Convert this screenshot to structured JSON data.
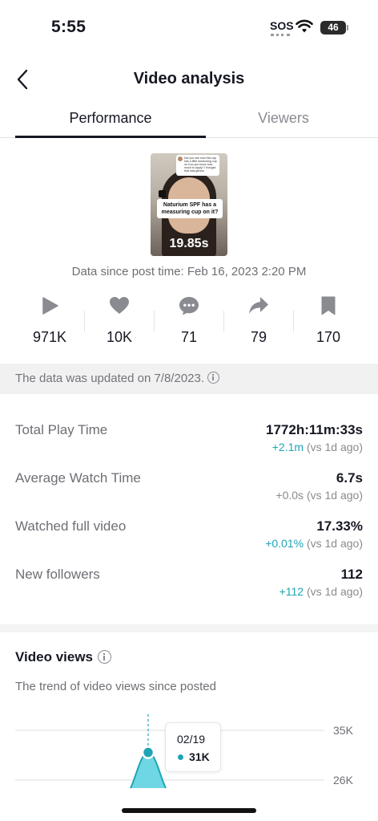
{
  "status_bar": {
    "time": "5:55",
    "sos": "SOS",
    "battery": "46"
  },
  "nav": {
    "title": "Video analysis"
  },
  "tabs": [
    {
      "label": "Performance",
      "active": true
    },
    {
      "label": "Viewers",
      "active": false
    }
  ],
  "video": {
    "duration": "19.85s",
    "caption": "Naturium SPF has a measuring cup on it?",
    "comment": "Did you see how this cap has a little measuring cup on it so you know how much to apply? I thought that was genius"
  },
  "data_since": "Data since post time: Feb 16, 2023 2:20 PM",
  "stats": [
    {
      "icon": "play-icon",
      "value": "971K"
    },
    {
      "icon": "heart-icon",
      "value": "10K"
    },
    {
      "icon": "comment-icon",
      "value": "71"
    },
    {
      "icon": "share-icon",
      "value": "79"
    },
    {
      "icon": "bookmark-icon",
      "value": "170"
    }
  ],
  "update_notice": "The data was updated on 7/8/2023.",
  "metrics": [
    {
      "label": "Total Play Time",
      "value": "1772h:11m:33s",
      "delta": "+2.1m",
      "delta_positive": true,
      "compare": " (vs 1d ago)"
    },
    {
      "label": "Average Watch Time",
      "value": "6.7s",
      "delta": "+0.0s",
      "delta_positive": false,
      "compare": " (vs 1d ago)"
    },
    {
      "label": "Watched full video",
      "value": "17.33%",
      "delta": "+0.01%",
      "delta_positive": true,
      "compare": " (vs 1d ago)"
    },
    {
      "label": "New followers",
      "value": "112",
      "delta": "+112",
      "delta_positive": true,
      "compare": " (vs 1d ago)"
    }
  ],
  "video_views": {
    "title": "Video views",
    "subtitle": "The trend of video views since posted",
    "tooltip": {
      "date": "02/19",
      "value": "31K"
    }
  },
  "colors": {
    "accent": "#20a4b5",
    "text": "#161823",
    "muted": "#8a8b91",
    "area_fill": "#5fd3e0"
  },
  "chart_data": {
    "type": "area",
    "y_tick_labels": [
      "35K",
      "26K"
    ],
    "grid": true,
    "highlighted_point": {
      "x": "02/19",
      "y": 31000
    },
    "series": [
      {
        "values": [
          26000,
          31000,
          26000
        ]
      }
    ]
  }
}
